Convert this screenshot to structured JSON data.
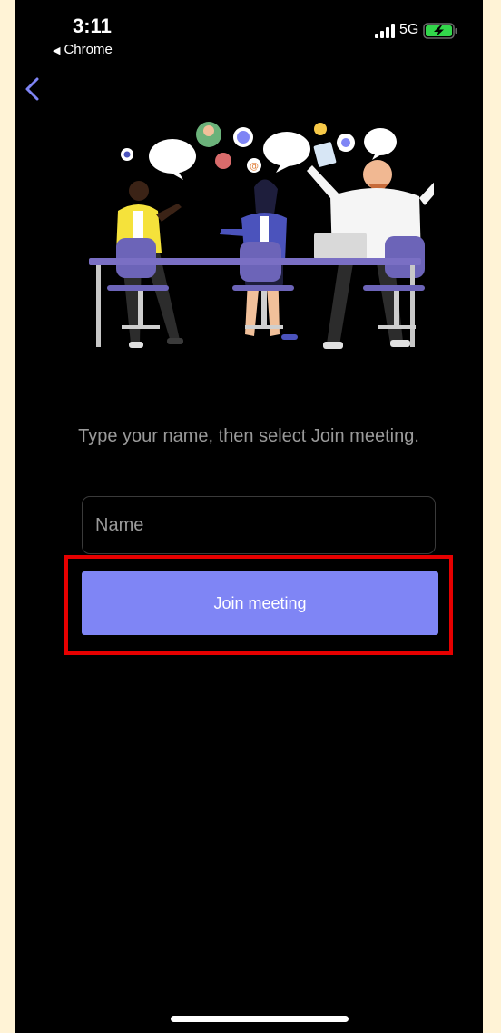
{
  "status_bar": {
    "time": "3:11",
    "back_app_label": "Chrome",
    "network": "5G",
    "icons": [
      "signal-icon",
      "battery-charging-icon",
      "back-triangle-icon"
    ]
  },
  "nav": {
    "back_icon": "chevron-left-icon"
  },
  "illustration": {
    "icon": "meeting-illustration"
  },
  "join": {
    "instruction": "Type your name, then select Join meeting.",
    "name_placeholder": "Name",
    "name_value": "",
    "button_label": "Join meeting"
  },
  "colors": {
    "background": "#000000",
    "button": "#7f85f5",
    "back_chevron": "#7f85f5",
    "highlight_border": "#e60000",
    "outer_margin": "#fff3d6"
  }
}
